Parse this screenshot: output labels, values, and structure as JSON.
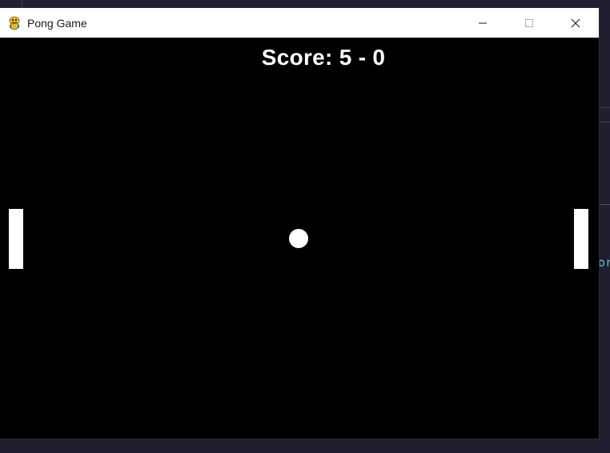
{
  "window": {
    "title": "Pong Game",
    "icon": "pygame-snake-icon",
    "controls": [
      "minimize-icon",
      "maximize-icon",
      "close-icon"
    ]
  },
  "game": {
    "score_text": "Score: 5 - 0",
    "score_left": 5,
    "score_right": 0,
    "background_color": "#000000",
    "foreground_color": "#ffffff"
  },
  "background_app": {
    "partial_text": "ors"
  }
}
